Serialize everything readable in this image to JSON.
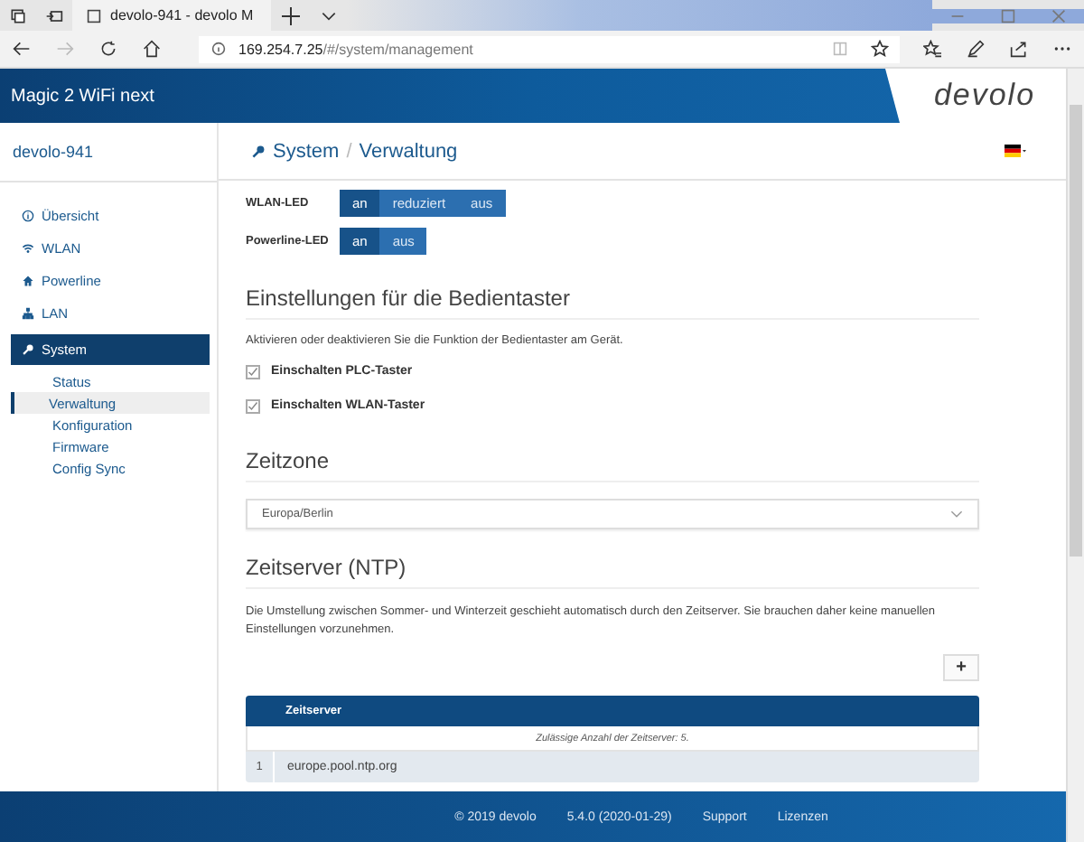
{
  "browser": {
    "tabs": [
      {
        "title": "devolo-941 - devolo M",
        "selected": true
      }
    ],
    "address_host": "169.254.7.25",
    "address_path": "/#/system/management"
  },
  "header": {
    "product": "Magic 2 WiFi next",
    "logo": "devolo"
  },
  "sidebar": {
    "device": "devolo-941",
    "items": [
      {
        "label": "Übersicht",
        "selected": false
      },
      {
        "label": "WLAN",
        "selected": false
      },
      {
        "label": "Powerline",
        "selected": false
      },
      {
        "label": "LAN",
        "selected": false
      },
      {
        "label": "System",
        "selected": true,
        "children": [
          {
            "label": "Status",
            "selected": false
          },
          {
            "label": "Verwaltung",
            "selected": true
          },
          {
            "label": "Konfiguration",
            "selected": false
          },
          {
            "label": "Firmware",
            "selected": false
          },
          {
            "label": "Config Sync",
            "selected": false
          }
        ]
      }
    ]
  },
  "breadcrumb": [
    "System",
    "Verwaltung"
  ],
  "breadcrumb_separator": "/",
  "led_settings": [
    {
      "label": "WLAN-LED",
      "options": [
        {
          "label": "an",
          "selected": true
        },
        {
          "label": "reduziert",
          "selected": false
        },
        {
          "label": "aus",
          "selected": false
        }
      ]
    },
    {
      "label": "Powerline-LED",
      "options": [
        {
          "label": "an",
          "selected": true
        },
        {
          "label": "aus",
          "selected": false
        }
      ]
    }
  ],
  "button_settings": {
    "title": "Einstellungen für die Bedientaster",
    "description": "Aktivieren oder deaktivieren Sie die Funktion der Bedientaster am Gerät.",
    "options": [
      {
        "label": "Einschalten PLC-Taster",
        "checked": true
      },
      {
        "label": "Einschalten WLAN-Taster",
        "checked": true
      }
    ]
  },
  "timezone": {
    "title": "Zeitzone",
    "value": "Europa/Berlin"
  },
  "ntp": {
    "title": "Zeitserver (NTP)",
    "description": "Die Umstellung zwischen Sommer- und Winterzeit geschieht automatisch durch den Zeitserver. Sie brauchen daher keine manuellen Einstellungen vorzunehmen.",
    "add_button": "+",
    "table": {
      "columns": [
        "Zeitserver"
      ],
      "note": "Zulässige Anzahl der Zeitserver: 5.",
      "rows": [
        {
          "number": "1",
          "server": "europe.pool.ntp.org"
        }
      ]
    }
  },
  "footer": [
    "© 2019  devolo",
    "5.4.0 (2020-01-29)",
    "Support",
    "Lizenzen"
  ]
}
